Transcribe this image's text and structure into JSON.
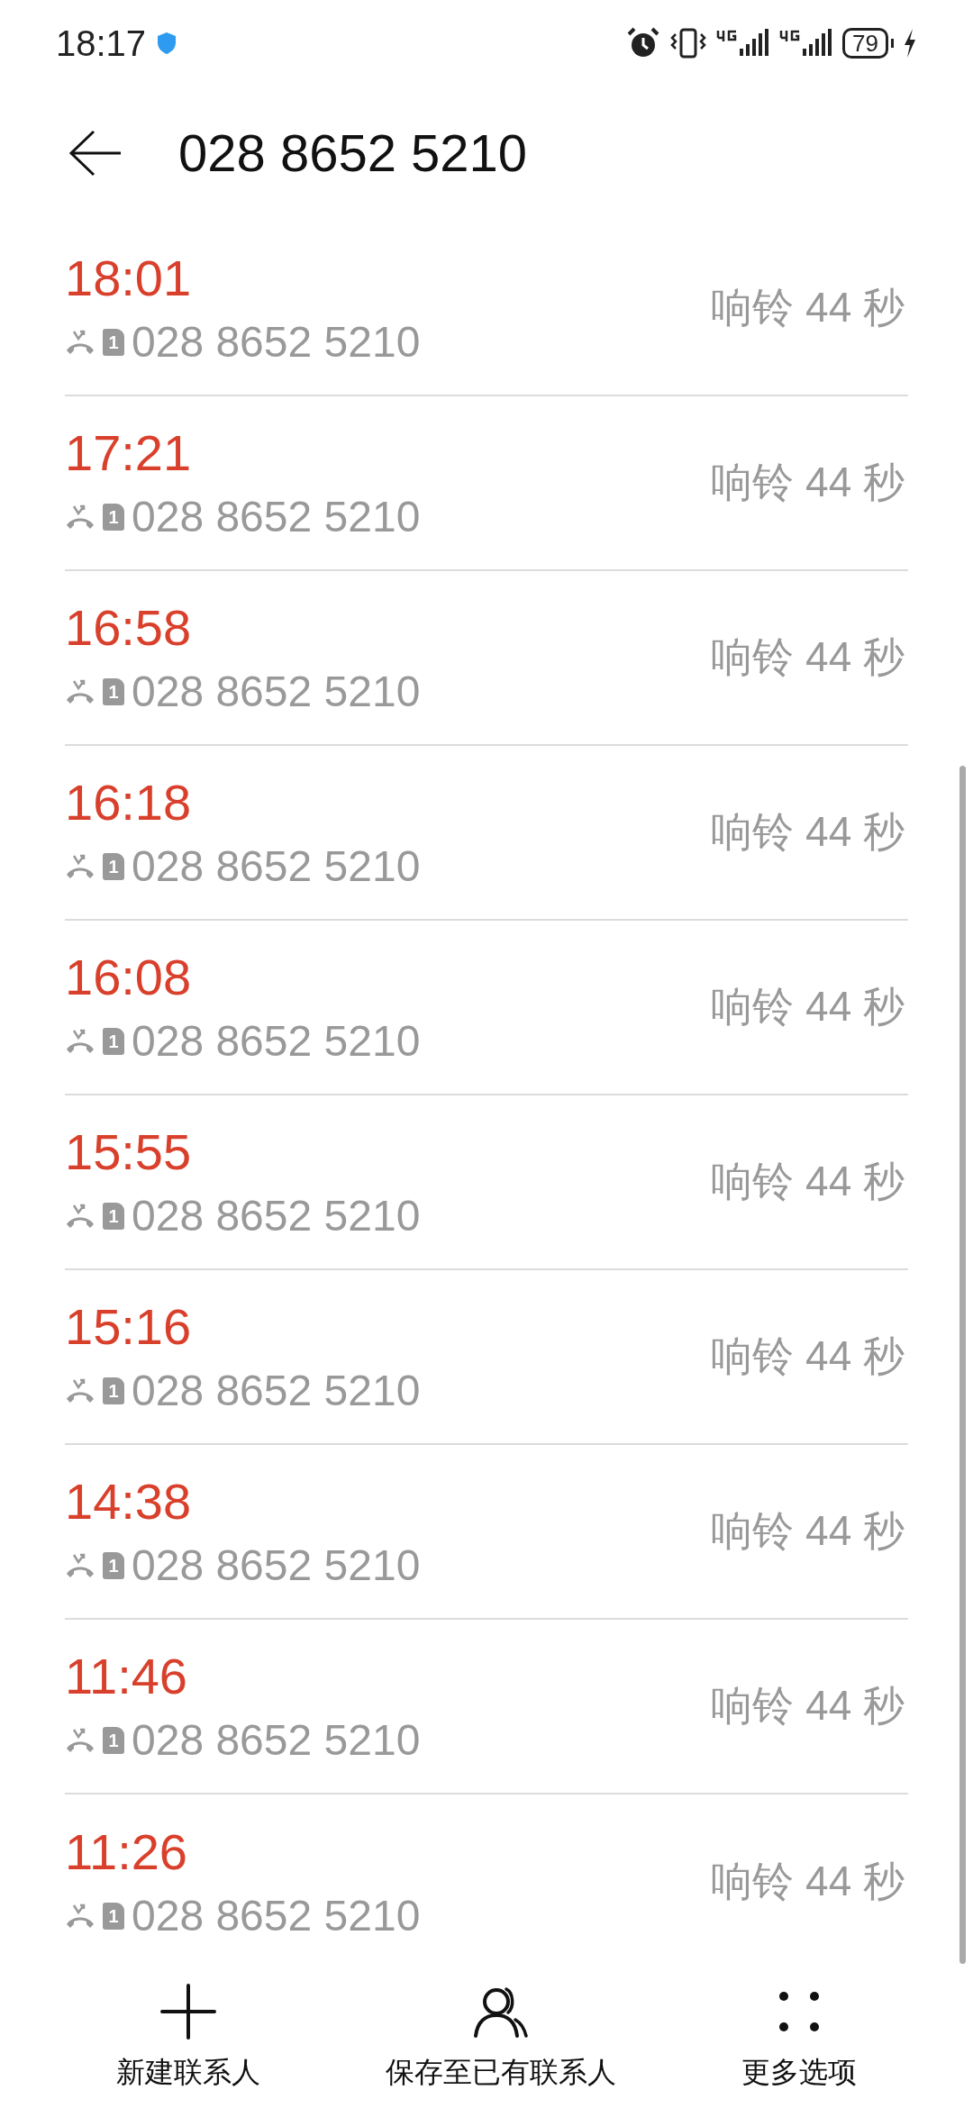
{
  "status_bar": {
    "time": "18:17",
    "battery": "79"
  },
  "header": {
    "title": "028 8652 5210"
  },
  "calls": [
    {
      "time": "18:01",
      "sim": "1",
      "number": "028 8652 5210",
      "duration": "响铃 44 秒",
      "kind": "missed"
    },
    {
      "time": "17:21",
      "sim": "1",
      "number": "028 8652 5210",
      "duration": "响铃 44 秒",
      "kind": "missed"
    },
    {
      "time": "16:58",
      "sim": "1",
      "number": "028 8652 5210",
      "duration": "响铃 44 秒",
      "kind": "missed"
    },
    {
      "time": "16:18",
      "sim": "1",
      "number": "028 8652 5210",
      "duration": "响铃 44 秒",
      "kind": "missed"
    },
    {
      "time": "16:08",
      "sim": "1",
      "number": "028 8652 5210",
      "duration": "响铃 44 秒",
      "kind": "missed"
    },
    {
      "time": "15:55",
      "sim": "1",
      "number": "028 8652 5210",
      "duration": "响铃 44 秒",
      "kind": "missed"
    },
    {
      "time": "15:16",
      "sim": "1",
      "number": "028 8652 5210",
      "duration": "响铃 44 秒",
      "kind": "missed"
    },
    {
      "time": "14:38",
      "sim": "1",
      "number": "028 8652 5210",
      "duration": "响铃 44 秒",
      "kind": "missed"
    },
    {
      "time": "11:46",
      "sim": "1",
      "number": "028 8652 5210",
      "duration": "响铃 44 秒",
      "kind": "missed"
    },
    {
      "time": "11:26",
      "sim": "1",
      "number": "028 8652 5210",
      "duration": "响铃 44 秒",
      "kind": "missed"
    }
  ],
  "bottom_actions": [
    {
      "label": "新建联系人",
      "kind": "add"
    },
    {
      "label": "保存至已有联系人",
      "kind": "contact"
    },
    {
      "label": "更多选项",
      "kind": "more"
    }
  ]
}
